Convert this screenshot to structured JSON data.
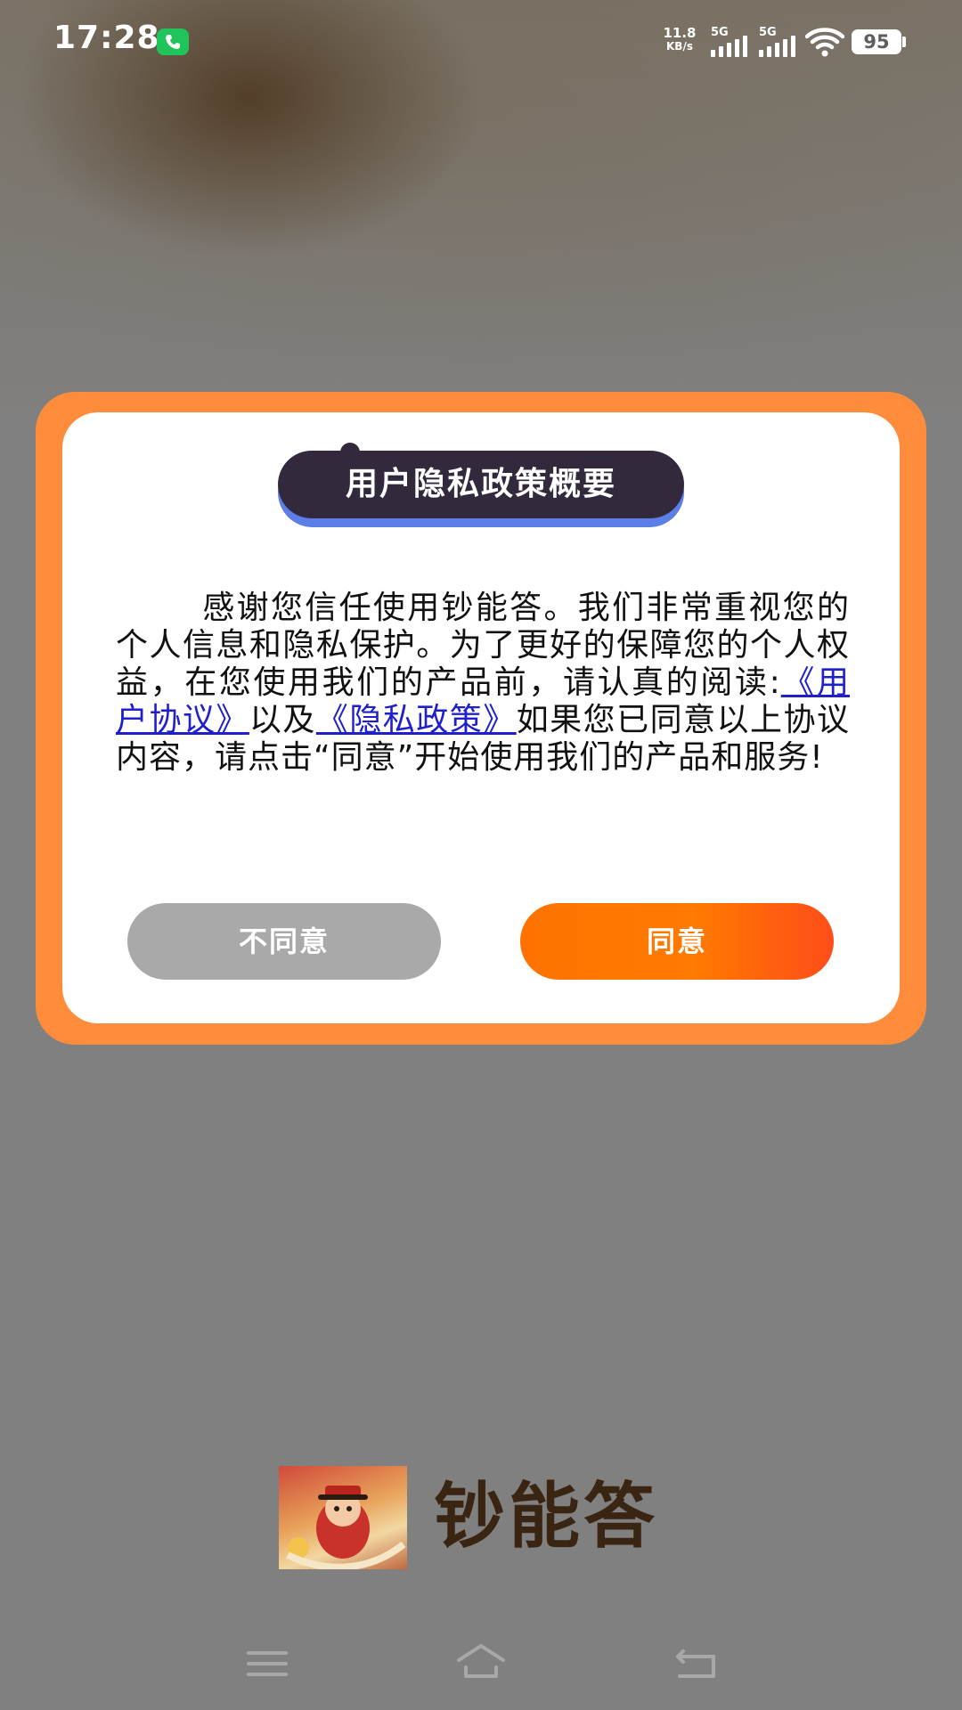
{
  "status_bar": {
    "time": "17:28",
    "net_speed_value": "11.8",
    "net_speed_unit": "KB/s",
    "signal_1_label": "5G",
    "signal_2_label": "5G",
    "battery": "95",
    "call_icon": "phone-icon",
    "wifi_icon": "wifi-icon"
  },
  "dialog": {
    "title": "用户隐私政策概要",
    "body_part1": "感谢您信任使用钞能答。我们非常重视您的个人信息和隐私保护。为了更好的保障您的个人权益，在您使用我们的产品前，请认真的阅读:",
    "link_user_agreement": "《用户协议》",
    "body_part2": "以及",
    "link_privacy_policy": "《隐私政策》",
    "body_part3": "如果您已同意以上协议内容，请点击“同意”开始使用我们的产品和服务!",
    "disagree_label": "不同意",
    "agree_label": "同意"
  },
  "brand": {
    "name": "钞能答"
  },
  "nav": {
    "menu_icon": "menu-icon",
    "home_icon": "home-icon",
    "back_icon": "back-icon"
  },
  "colors": {
    "frame_orange": "#ff8c3b",
    "title_pill": "#33293d",
    "link_blue": "#1f1fcc",
    "agree_orange": "#ff7200",
    "disagree_gray": "#a9a9a9",
    "brand_brown": "#3a2412"
  }
}
